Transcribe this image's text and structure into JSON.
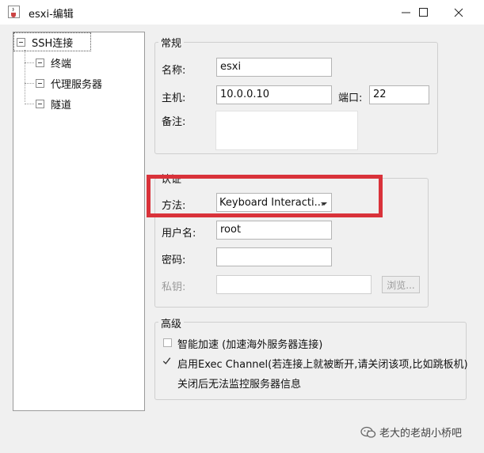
{
  "window": {
    "title": "esxi-编辑",
    "icons": {
      "app": "java-cup-icon",
      "minimize": "minimize-icon",
      "maximize": "maximize-icon",
      "close": "close-icon"
    }
  },
  "tree": {
    "root": "SSH连接",
    "children": [
      "终端",
      "代理服务器",
      "隧道"
    ]
  },
  "general": {
    "title": "常规",
    "name_label": "名称:",
    "name_value": "esxi",
    "host_label": "主机:",
    "host_value": "10.0.0.10",
    "port_label": "端口:",
    "port_value": "22",
    "note_label": "备注:"
  },
  "auth": {
    "title": "认证",
    "method_label": "方法:",
    "method_value": "Keyboard Interacti...",
    "user_label": "用户名:",
    "user_value": "root",
    "password_label": "密码:",
    "key_label": "私钥:",
    "browse_label": "浏览..."
  },
  "advanced": {
    "title": "高级",
    "smart_accel_label": "智能加速 (加速海外服务器连接)",
    "smart_accel_checked": false,
    "exec_channel_label": "启用Exec Channel(若连接上就被断开,请关闭该项,比如跳板机)",
    "exec_channel_checked": true,
    "exec_channel_note": "关闭后无法监控服务器信息"
  },
  "watermark": {
    "text": "老大的老胡小桥吧",
    "icon": "wechat-icon"
  },
  "colors": {
    "highlight": "#d9323a",
    "background": "#f0f0f0"
  }
}
